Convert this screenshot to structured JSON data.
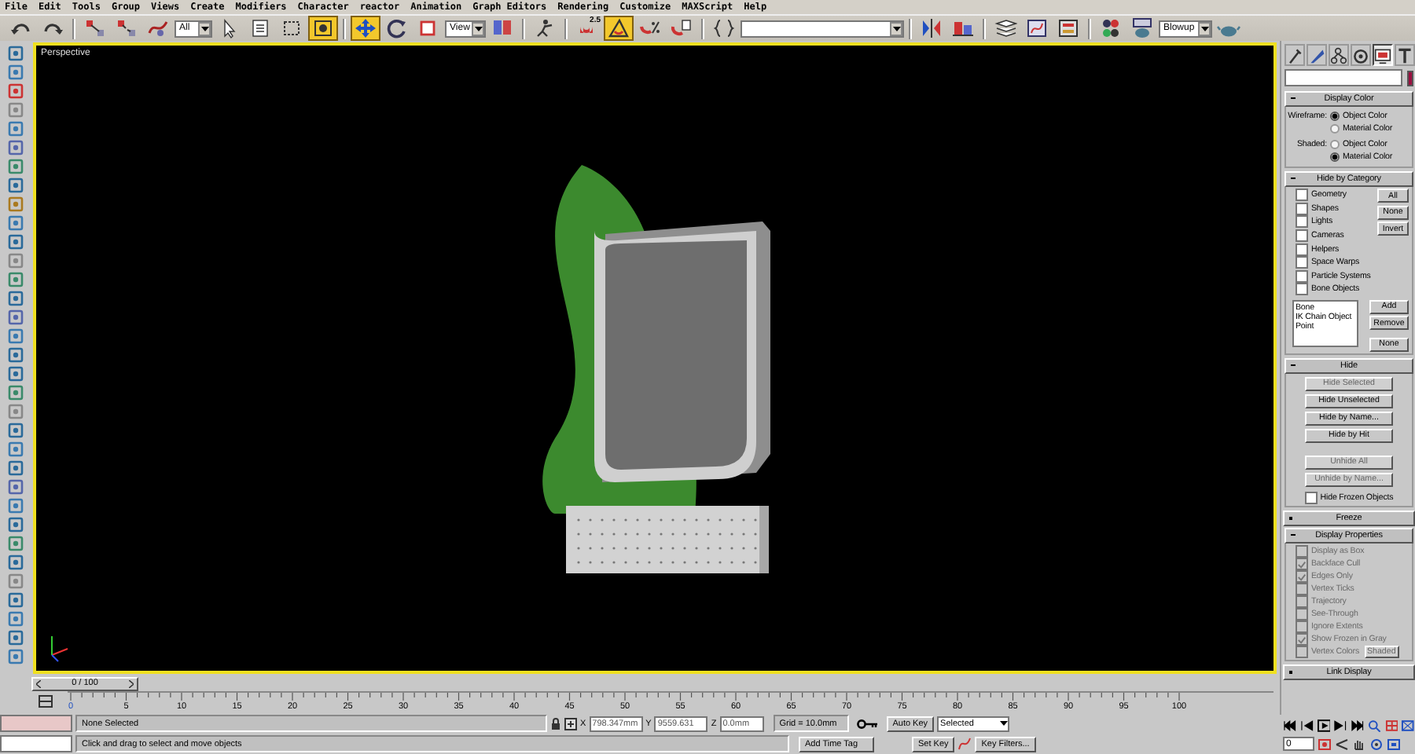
{
  "menu": [
    "File",
    "Edit",
    "Tools",
    "Group",
    "Views",
    "Create",
    "Modifiers",
    "Character",
    "reactor",
    "Animation",
    "Graph Editors",
    "Rendering",
    "Customize",
    "MAXScript",
    "Help"
  ],
  "toolbar": [
    {
      "kind": "undo",
      "active": false
    },
    {
      "kind": "redo",
      "active": false
    },
    {
      "kind": "sep"
    },
    {
      "kind": "link",
      "active": false
    },
    {
      "kind": "unlink",
      "active": false
    },
    {
      "kind": "bind",
      "active": false
    },
    {
      "kind": "dropdown",
      "value": "All"
    },
    {
      "kind": "select",
      "active": false
    },
    {
      "kind": "select_name",
      "active": false
    },
    {
      "kind": "region",
      "active": false
    },
    {
      "kind": "crossing",
      "active": true
    },
    {
      "kind": "sep"
    },
    {
      "kind": "move",
      "active": true
    },
    {
      "kind": "rotate",
      "active": false
    },
    {
      "kind": "scale",
      "active": false
    },
    {
      "kind": "dropdown",
      "value": "View"
    },
    {
      "kind": "pivot",
      "active": false
    },
    {
      "kind": "sep"
    },
    {
      "kind": "manipulate",
      "active": false
    },
    {
      "kind": "sep"
    },
    {
      "kind": "snap",
      "active": false,
      "label": "2.5"
    },
    {
      "kind": "angle_snap",
      "active": true
    },
    {
      "kind": "percent_snap",
      "active": false
    },
    {
      "kind": "spinner_snap",
      "active": false
    },
    {
      "kind": "sep"
    },
    {
      "kind": "named_sets",
      "active": false
    },
    {
      "kind": "dropdown"
    },
    {
      "kind": "sep"
    },
    {
      "kind": "mirror",
      "active": false
    },
    {
      "kind": "align",
      "active": false
    },
    {
      "kind": "sep"
    },
    {
      "kind": "layers",
      "active": false
    },
    {
      "kind": "curve_editor",
      "active": false
    },
    {
      "kind": "schematic",
      "active": false
    },
    {
      "kind": "sep"
    },
    {
      "kind": "material",
      "active": false
    },
    {
      "kind": "render_scene",
      "active": false
    },
    {
      "kind": "dropdown",
      "value": "Blowup"
    },
    {
      "kind": "quick_render",
      "active": false
    }
  ],
  "viewport": {
    "label": "Perspective",
    "active": true
  },
  "command_panel": {
    "tabs": [
      {
        "kind": "create",
        "selected": false
      },
      {
        "kind": "modify",
        "selected": false
      },
      {
        "kind": "hierarchy",
        "selected": false
      },
      {
        "kind": "motion",
        "selected": false
      },
      {
        "kind": "display",
        "selected": true
      },
      {
        "kind": "utilities",
        "selected": false
      }
    ],
    "rollouts": [
      {
        "kind": "display_color",
        "title": "Display Color",
        "expanded": true,
        "rows": [
          {
            "label": "Wireframe:",
            "options": [
              {
                "label": "Object Color",
                "selected": true
              },
              {
                "label": "Material Color",
                "selected": false
              }
            ]
          },
          {
            "label": "Shaded:",
            "options": [
              {
                "label": "Object Color",
                "selected": false
              },
              {
                "label": "Material Color",
                "selected": true
              }
            ]
          }
        ]
      },
      {
        "kind": "hide_by_category",
        "title": "Hide by Category",
        "expanded": true,
        "categories": [
          {
            "label": "Geometry",
            "checked": false
          },
          {
            "label": "Shapes",
            "checked": false
          },
          {
            "label": "Lights",
            "checked": false
          },
          {
            "label": "Cameras",
            "checked": false
          },
          {
            "label": "Helpers",
            "checked": false
          },
          {
            "label": "Space Warps",
            "checked": false
          },
          {
            "label": "Particle Systems",
            "checked": false
          },
          {
            "label": "Bone Objects",
            "checked": false
          }
        ],
        "buttons": [
          "All",
          "None",
          "Invert"
        ],
        "list": [
          "Bone",
          "IK Chain Object",
          "Point"
        ],
        "list_buttons": [
          "Add",
          "Remove",
          "None"
        ]
      },
      {
        "kind": "hide",
        "title": "Hide",
        "expanded": true,
        "groups": [
          [
            {
              "label": "Hide Selected",
              "disabled": true
            },
            {
              "label": "Hide Unselected",
              "disabled": false
            },
            {
              "label": "Hide by Name...",
              "disabled": false
            },
            {
              "label": "Hide by Hit",
              "disabled": false
            }
          ],
          [
            {
              "label": "Unhide All",
              "disabled": true
            },
            {
              "label": "Unhide by Name...",
              "disabled": true
            }
          ]
        ],
        "option": {
          "label": "Hide Frozen Objects",
          "checked": false
        }
      },
      {
        "kind": "collapsed",
        "title": "Freeze",
        "expanded": false
      },
      {
        "kind": "display_properties",
        "title": "Display Properties",
        "expanded": true,
        "options": [
          {
            "label": "Display as Box",
            "checked": false,
            "disabled": true
          },
          {
            "label": "Backface Cull",
            "checked": true,
            "disabled": true
          },
          {
            "label": "Edges Only",
            "checked": true,
            "disabled": true
          },
          {
            "label": "Vertex Ticks",
            "checked": false,
            "disabled": true
          },
          {
            "label": "Trajectory",
            "checked": false,
            "disabled": true
          },
          {
            "label": "See-Through",
            "checked": false,
            "disabled": true
          },
          {
            "label": "Ignore Extents",
            "checked": false,
            "disabled": true
          },
          {
            "label": "Show Frozen in Gray",
            "checked": true,
            "disabled": true
          },
          {
            "label": "Vertex Colors",
            "checked": false,
            "disabled": true,
            "button": "Shaded"
          }
        ]
      },
      {
        "kind": "collapsed",
        "title": "Link Display",
        "expanded": false
      }
    ]
  },
  "time_slider": {
    "label": "0 / 100",
    "level": 0
  },
  "track_ticks": [
    "0",
    "5",
    "10",
    "15",
    "20",
    "25",
    "30",
    "35",
    "40",
    "45",
    "50",
    "55",
    "60",
    "65",
    "70",
    "75",
    "80",
    "85",
    "90",
    "95",
    "100"
  ],
  "status": {
    "selection": "None Selected",
    "prompt": "Click and drag to select and move objects",
    "coords": [
      {
        "label": "X",
        "value": "798.347mm"
      },
      {
        "label": "Y",
        "value": "9559.631"
      },
      {
        "label": "Z",
        "value": "0.0mm"
      }
    ],
    "grid": "Grid = 10.0mm",
    "time_tag": "Add Time Tag"
  },
  "animation": {
    "auto_key": "Auto Key",
    "set_key": "Set Key",
    "key_mode": "Selected",
    "key_filters": "Key Filters...",
    "frame": "0"
  }
}
